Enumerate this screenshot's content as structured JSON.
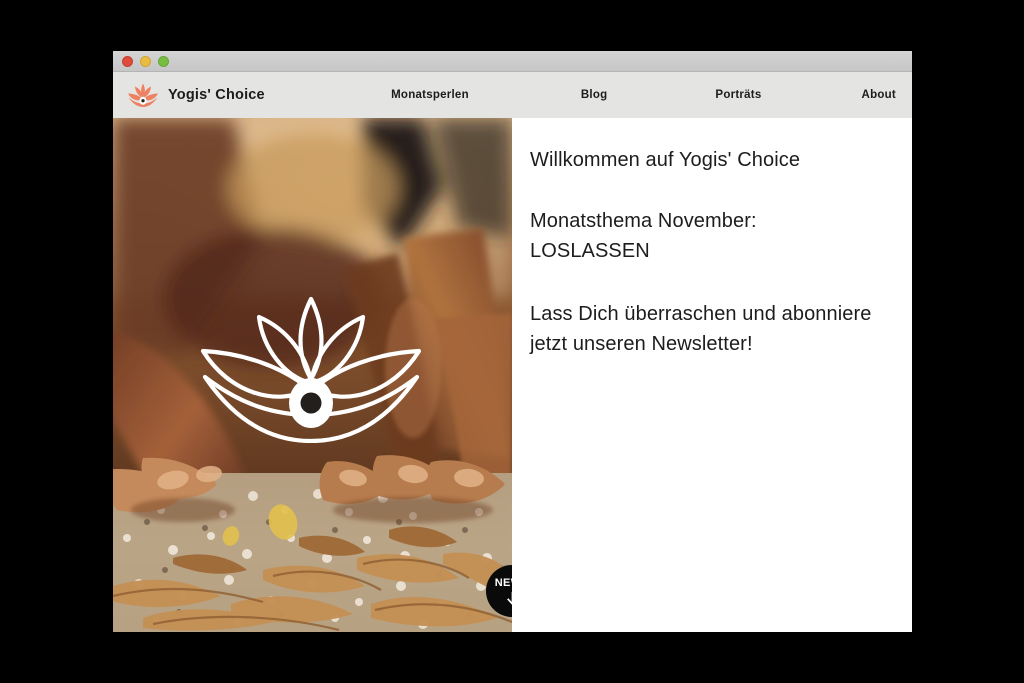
{
  "window": {
    "traffic_lights": [
      {
        "name": "close-button",
        "color": "#dd4b3c"
      },
      {
        "name": "minimize-button",
        "color": "#e9bb3f"
      },
      {
        "name": "zoom-button",
        "color": "#77bd42"
      }
    ]
  },
  "header": {
    "logo_icon": "lotus-eye-logo-icon",
    "brand_name": "Yogis' Choice",
    "brand_color": "#e8795a",
    "nav": [
      {
        "label": "Monatsperlen"
      },
      {
        "label": "Blog"
      },
      {
        "label": "Porträts"
      },
      {
        "label": "About"
      }
    ]
  },
  "hero": {
    "photo_alt": "Hands reaching into dried autumn leaves on gravel",
    "overlay_icon": "lotus-eye-overlay-icon",
    "news_button": {
      "label": "NEWS",
      "arrow_icon": "arrow-down-icon",
      "background": "#0a0a0a",
      "text_color": "#ffffff"
    }
  },
  "content": {
    "heading": "Willkommen auf Yogis' Choice",
    "paragraph_theme_line1": "Monatsthema November:",
    "paragraph_theme_line2": "LOSLASSEN",
    "paragraph_newsletter": "Lass Dich überraschen und abonniere jetzt unseren Newsletter!",
    "text_color": "#1d1d1d"
  }
}
